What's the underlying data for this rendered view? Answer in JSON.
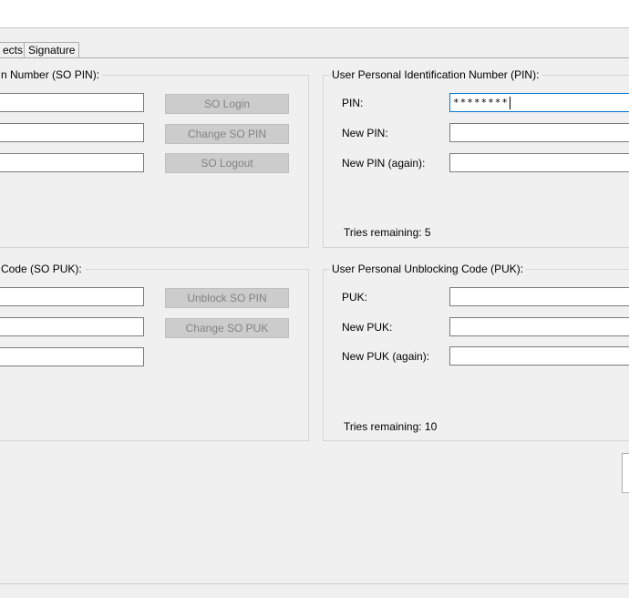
{
  "tabs": {
    "objects_label": "ects",
    "signature_label": "Signature"
  },
  "so_pin": {
    "title": "n Number (SO PIN):",
    "login_label": "SO Login",
    "change_label": "Change SO PIN",
    "logout_label": "SO Logout"
  },
  "user_pin": {
    "title": "User Personal Identification Number (PIN):",
    "pin_label": "PIN:",
    "pin_value": "********",
    "new_pin_label": "New PIN:",
    "new_pin_again_label": "New PIN (again):",
    "tries": "Tries remaining: 5"
  },
  "so_puk": {
    "title": "Code (SO PUK):",
    "unblock_label": "Unblock SO PIN",
    "change_label": "Change SO PUK"
  },
  "user_puk": {
    "title": "User Personal Unblocking Code (PUK):",
    "puk_label": "PUK:",
    "new_puk_label": "New PUK:",
    "new_puk_again_label": "New PUK (again):",
    "tries": "Tries remaining: 10"
  }
}
